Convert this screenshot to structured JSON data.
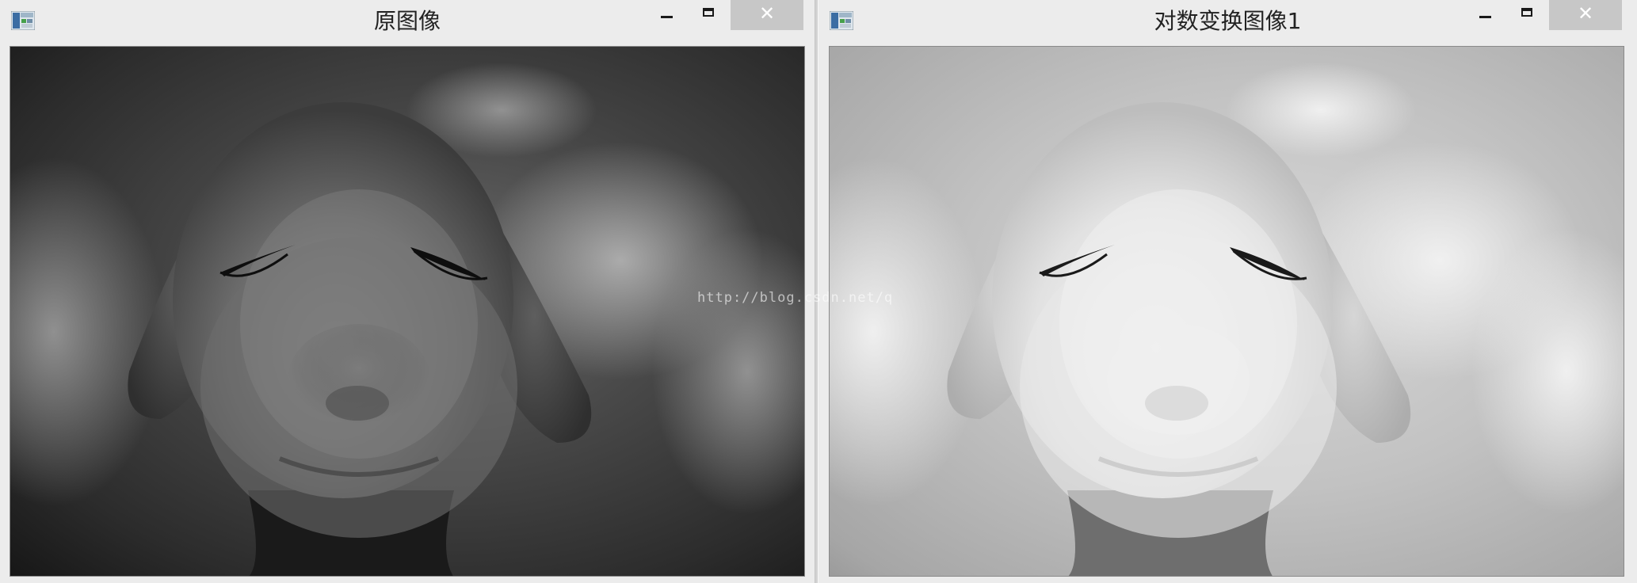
{
  "windows": [
    {
      "title": "原图像",
      "buttons": {
        "minimize": "minimize",
        "maximize": "maximize",
        "close": "✕"
      },
      "image": "grayscale photo of a toy dog head with closed eyes, dark tones"
    },
    {
      "title": "对数变换图像1",
      "buttons": {
        "minimize": "minimize",
        "maximize": "maximize",
        "close": "✕"
      },
      "image": "same photo after log transform, much brighter tones"
    }
  ],
  "watermark": "http://blog.csdn.net/q",
  "icons": {
    "app": "app-window-icon",
    "minimize": "minimize-icon",
    "maximize": "maximize-icon",
    "close": "close-icon"
  },
  "colors": {
    "titlebar": "#ececec",
    "close_button": "#c7c7c7",
    "left_bg": "#3a3a3a",
    "right_bg": "#c8c8c8"
  }
}
